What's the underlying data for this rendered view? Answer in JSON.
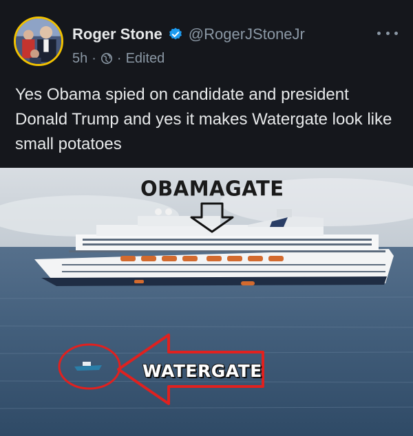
{
  "author": {
    "display_name": "Roger Stone",
    "handle": "@RogerJStoneJr",
    "verified": true,
    "avatar_icon": "profile-photo"
  },
  "meta": {
    "time": "5h",
    "separator": "·",
    "visibility_icon": "globe-icon",
    "edited_label": "Edited"
  },
  "post": {
    "text": "Yes Obama spied on candidate and president Donald Trump and yes it makes Watergate look like small potatoes"
  },
  "media": {
    "top_label": "OBAMAGATE",
    "bottom_label": "WATERGATE"
  },
  "colors": {
    "background": "#15171c",
    "verified_badge": "#1d9bf0",
    "arrow_red": "#e0211f",
    "avatar_ring": "#f2c200"
  }
}
